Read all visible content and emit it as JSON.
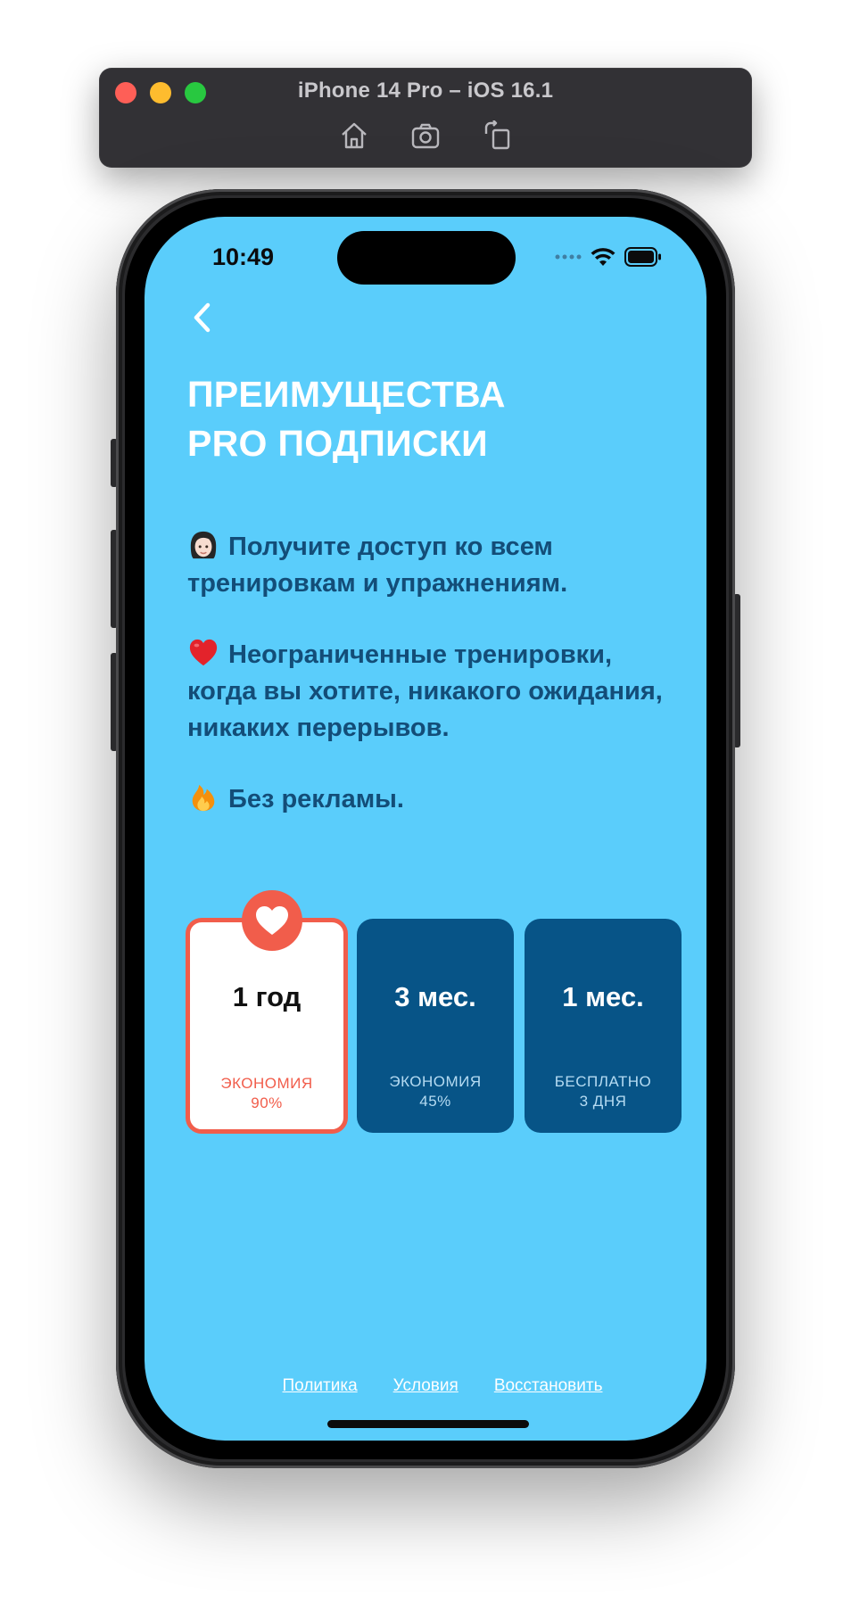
{
  "simulator": {
    "title": "iPhone 14 Pro – iOS 16.1",
    "tools": [
      "home-icon",
      "screenshot-icon",
      "rotate-icon"
    ]
  },
  "status_bar": {
    "time": "10:49",
    "icons": [
      "cellular-signal-icon",
      "wifi-icon",
      "battery-icon"
    ]
  },
  "header": {
    "back_icon": "chevron-left-icon",
    "title_line1": "ПРЕИМУЩЕСТВА",
    "title_line2": "PRO ПОДПИСКИ"
  },
  "features": [
    {
      "emoji": "woman-face-emoji",
      "text": "Получите доступ ко всем тренировкам и упражнениям."
    },
    {
      "emoji": "red-heart-emoji",
      "text": "Неограниченные тренировки, когда вы хотите, никакого ожидания, никаких перерывов."
    },
    {
      "emoji": "fire-emoji",
      "text": "Без рекламы."
    }
  ],
  "plans": [
    {
      "name": "1 год",
      "note_line1": "ЭКОНОМИЯ",
      "note_line2": "90%",
      "selected": true,
      "badge_icon": "heart-icon"
    },
    {
      "name": "3 мес.",
      "note_line1": "ЭКОНОМИЯ",
      "note_line2": "45%",
      "selected": false
    },
    {
      "name": "1 мес.",
      "note_line1": "БЕСПЛАТНО",
      "note_line2": "3 ДНЯ",
      "selected": false
    }
  ],
  "footer": {
    "policy": "Политика",
    "terms": "Условия",
    "restore": "Восстановить"
  },
  "colors": {
    "screen_background": "#5acdfb",
    "plan_background": "#075487",
    "accent": "#f15d4b",
    "feature_text": "#134d78"
  }
}
